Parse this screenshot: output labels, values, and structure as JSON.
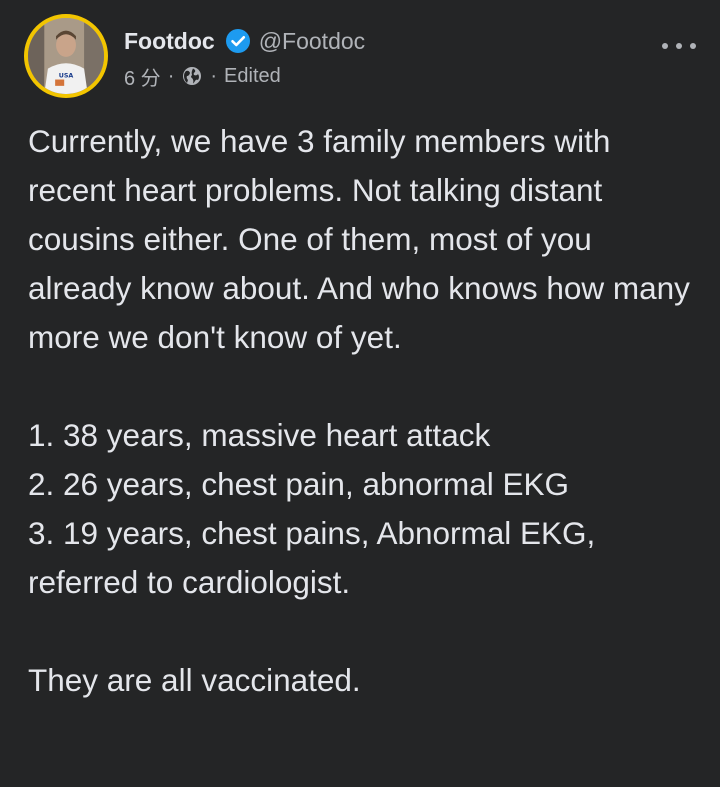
{
  "post": {
    "author_name": "Footdoc",
    "author_handle": "@Footdoc",
    "timestamp": "6 分",
    "separator": "·",
    "edited_label": "Edited",
    "paragraph_1": "Currently, we have 3 family members with recent heart problems. Not talking distant cousins either. One of them, most of you already know about. And who knows how many more we don't know of yet.",
    "list": [
      "1. 38 years, massive heart attack",
      "2. 26 years, chest pain, abnormal EKG",
      "3. 19 years, chest pains, Abnormal EKG, referred to cardiologist."
    ],
    "closing": "They are all vaccinated."
  },
  "icons": {
    "verified": "verified-badge-icon",
    "privacy": "globe-icon",
    "more": "more-options-icon"
  },
  "colors": {
    "background": "#242526",
    "text_primary": "#e4e6eb",
    "text_secondary": "#b0b3b8",
    "verified_blue": "#1d9bf0",
    "avatar_ring": "#f2c500"
  }
}
